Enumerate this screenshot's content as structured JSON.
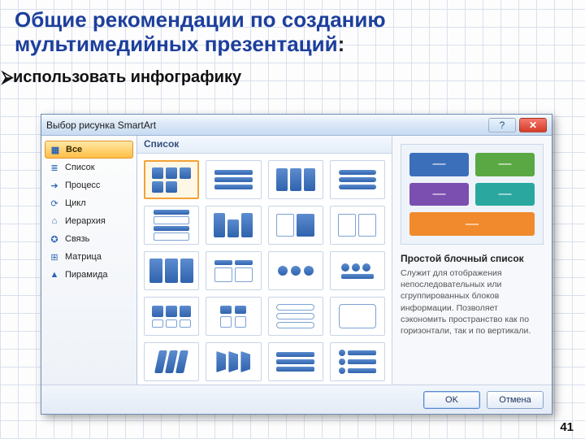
{
  "slide": {
    "title": "Общие рекомендации по созданию мультимедийных презентаций",
    "title_colon": ":",
    "bullet": "использовать инфографику",
    "page_number": "41"
  },
  "dialog": {
    "title": "Выбор рисунка SmartArt",
    "help_glyph": "?",
    "close_glyph": "✕",
    "gallery_header": "Список",
    "categories": [
      {
        "icon": "▦",
        "label": "Все",
        "selected": true
      },
      {
        "icon": "≣",
        "label": "Список"
      },
      {
        "icon": "➔",
        "label": "Процесс"
      },
      {
        "icon": "⟳",
        "label": "Цикл"
      },
      {
        "icon": "⌂",
        "label": "Иерархия"
      },
      {
        "icon": "✪",
        "label": "Связь"
      },
      {
        "icon": "⊞",
        "label": "Матрица"
      },
      {
        "icon": "▲",
        "label": "Пирамида"
      }
    ],
    "buttons": {
      "ok": "OK",
      "cancel": "Отмена"
    }
  },
  "preview": {
    "title": "Простой блочный список",
    "description": "Служит для отображения непоследовательных или сгруппированных блоков информации. Позволяет сэкономить пространство как по горизонтали, так и по вертикали.",
    "tiles": [
      {
        "color": "#3c6fb9"
      },
      {
        "color": "#5aa843"
      },
      {
        "color": "#7a4fb0"
      },
      {
        "color": "#2aa8a0"
      },
      {
        "color": "#f08a2c",
        "span": 2
      }
    ]
  }
}
